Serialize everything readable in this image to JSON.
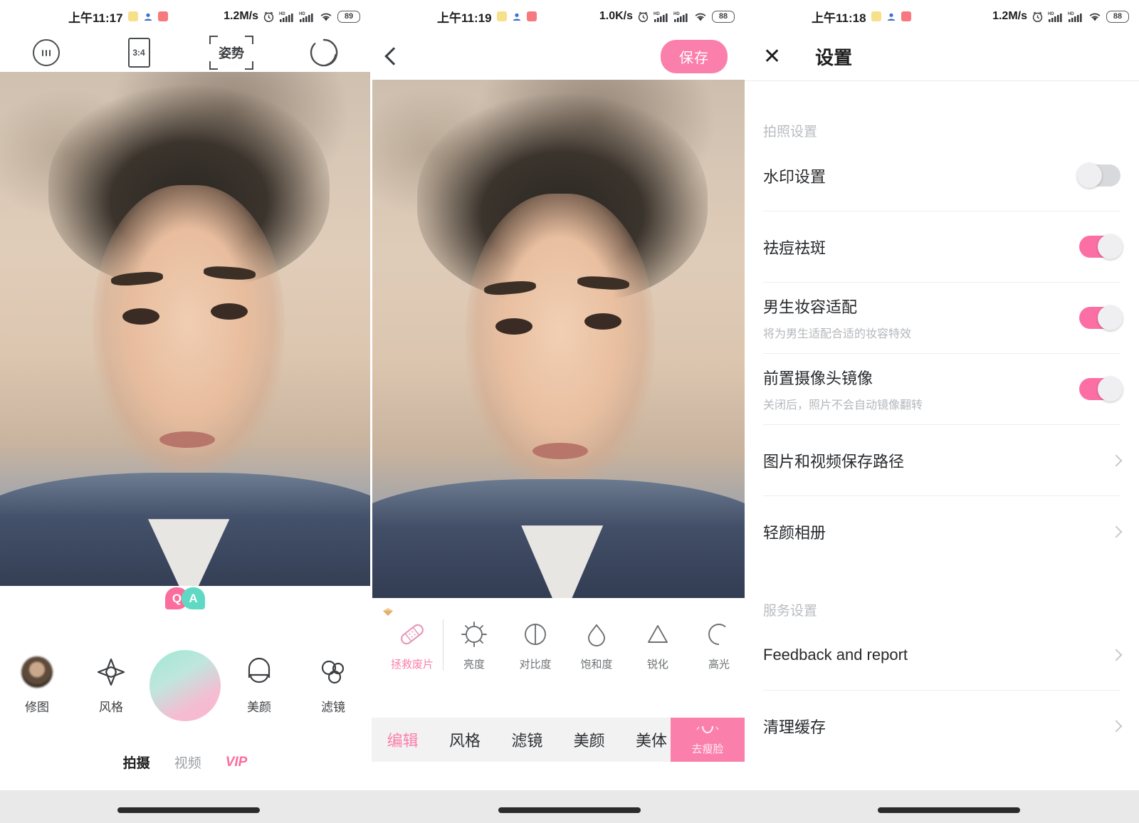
{
  "panels": {
    "camera": {
      "status": {
        "time": "上午11:17",
        "speed": "1.2M/s",
        "battery": "89"
      },
      "toolbar": {
        "menu_icon": "three-dots-circle-icon",
        "ratio_label": "3:4",
        "pose_label": "姿势",
        "flip_icon": "camera-flip-icon"
      },
      "left_tools": [
        {
          "label": "修图",
          "icon": "photo-thumbnail-icon"
        },
        {
          "label": "风格",
          "icon": "sparkle-icon"
        }
      ],
      "right_tools": [
        {
          "label": "美颜",
          "icon": "face-beauty-icon"
        },
        {
          "label": "滤镜",
          "icon": "filter-circles-icon"
        }
      ],
      "qa_badge": {
        "q": "Q",
        "a": "A"
      },
      "shutter": {
        "name": "shutter-button"
      },
      "tabs": [
        {
          "label": "拍摄",
          "selected": true
        },
        {
          "label": "视频",
          "selected": false
        },
        {
          "label": "VIP",
          "selected": false,
          "style": "vip"
        }
      ]
    },
    "editor": {
      "status": {
        "time": "上午11:19",
        "speed": "1.0K/s",
        "battery": "88"
      },
      "back_icon": "back-chevron-icon",
      "save_label": "保存",
      "adjustments": [
        {
          "label": "拯救废片",
          "icon": "bandage-icon",
          "vip": true
        },
        {
          "label": "亮度",
          "icon": "brightness-icon",
          "vip": false
        },
        {
          "label": "对比度",
          "icon": "contrast-icon",
          "vip": false
        },
        {
          "label": "饱和度",
          "icon": "saturation-drop-icon",
          "vip": false
        },
        {
          "label": "锐化",
          "icon": "sharpen-triangle-icon",
          "vip": false
        },
        {
          "label": "高光",
          "icon": "highlight-circle-icon",
          "vip": false
        }
      ],
      "tabs": [
        {
          "label": "编辑",
          "selected": true
        },
        {
          "label": "风格",
          "selected": false
        },
        {
          "label": "滤镜",
          "selected": false
        },
        {
          "label": "美颜",
          "selected": false
        },
        {
          "label": "美体",
          "selected": false
        }
      ],
      "face_button": {
        "label": "去瘦脸",
        "icon": "slim-face-icon"
      }
    },
    "settings": {
      "status": {
        "time": "上午11:18",
        "speed": "1.2M/s",
        "battery": "88"
      },
      "close_icon": "close-x-icon",
      "title": "设置",
      "group1_label": "拍照设置",
      "group1_rows": [
        {
          "title": "水印设置",
          "sub": "",
          "control": "toggle",
          "on": false
        },
        {
          "title": "祛痘祛斑",
          "sub": "",
          "control": "toggle",
          "on": true
        },
        {
          "title": "男生妆容适配",
          "sub": "将为男生适配合适的妆容特效",
          "control": "toggle",
          "on": true
        },
        {
          "title": "前置摄像头镜像",
          "sub": "关闭后，照片不会自动镜像翻转",
          "control": "toggle",
          "on": true
        },
        {
          "title": "图片和视频保存路径",
          "sub": "",
          "control": "chevron"
        },
        {
          "title": "轻颜相册",
          "sub": "",
          "control": "chevron"
        }
      ],
      "group2_label": "服务设置",
      "group2_rows": [
        {
          "title": "Feedback and report",
          "sub": "",
          "control": "chevron"
        },
        {
          "title": "清理缓存",
          "sub": "",
          "control": "chevron"
        }
      ]
    }
  },
  "colors": {
    "accent_pink": "#fb6fa4",
    "accent_pink_soft": "#fb7fab",
    "mint": "#5fd9c3",
    "text_primary": "#26292c",
    "text_muted": "#b4b7bb"
  }
}
